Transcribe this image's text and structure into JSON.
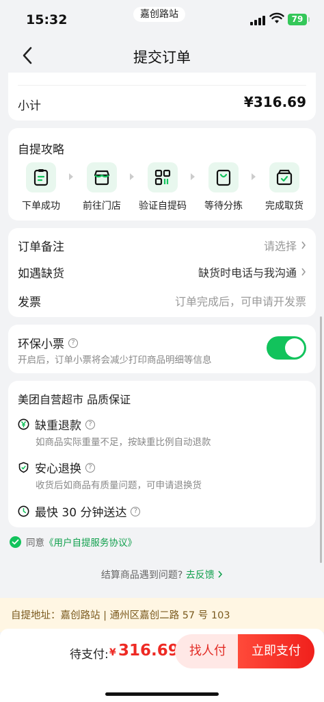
{
  "status_bar": {
    "time": "15:32",
    "center_label": "嘉创路站",
    "battery": "79"
  },
  "nav": {
    "back_icon": "chevron-left-icon",
    "title": "提交订单"
  },
  "subtotal": {
    "label": "小计",
    "value": "¥316.69"
  },
  "pickup_guide": {
    "title": "自提攻略",
    "steps": [
      {
        "label": "下单成功",
        "icon": "clipboard-icon"
      },
      {
        "label": "前往门店",
        "icon": "store-icon"
      },
      {
        "label": "验证自提码",
        "icon": "qrcode-icon"
      },
      {
        "label": "等待分拣",
        "icon": "bag-icon"
      },
      {
        "label": "完成取货",
        "icon": "box-check-icon"
      }
    ]
  },
  "order_options": {
    "remark": {
      "label": "订单备注",
      "value": "请选择"
    },
    "out_of_stock": {
      "label": "如遇缺货",
      "value": "缺货时电话与我沟通"
    },
    "invoice": {
      "label": "发票",
      "value": "订单完成后，可申请开发票"
    }
  },
  "eco_receipt": {
    "title": "环保小票",
    "description": "开启后，订单小票将会减少打印商品明细等信息",
    "enabled": true
  },
  "quality": {
    "title": "美团自营超市 品质保证",
    "items": [
      {
        "title": "缺重退款",
        "description": "如商品实际重量不足，按缺重比例自动退款",
        "icon": "yuan-circle-icon"
      },
      {
        "title": "安心退换",
        "description": "收货后如商品有质量问题，可申请退换货",
        "icon": "shield-icon"
      },
      {
        "title": "最快 30 分钟送达",
        "description": "",
        "icon": "clock-icon"
      }
    ]
  },
  "agreement": {
    "prefix": "同意",
    "link": "《用户自提服务协议》"
  },
  "feedback": {
    "text": "结算商品遇到问题?",
    "link": "去反馈"
  },
  "address": {
    "text": "自提地址：嘉创路站 | 通州区嘉创二路 57 号 103"
  },
  "checkout": {
    "pay_label": "待支付:",
    "currency": "¥",
    "amount": "316.69",
    "friend_pay_label": "找人付",
    "pay_now_label": "立即支付"
  },
  "colors": {
    "accent_green": "#12c35c",
    "price_red": "#ee2a24",
    "address_bg": "#fff6e3"
  }
}
